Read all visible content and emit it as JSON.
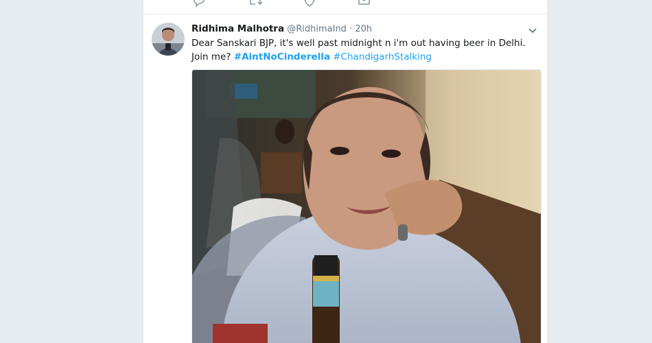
{
  "prev_tweet_actions": [
    {
      "name": "reply-icon"
    },
    {
      "name": "retweet-icon"
    },
    {
      "name": "like-icon"
    },
    {
      "name": "message-icon"
    }
  ],
  "tweet": {
    "author_name": "Ridhima Malhotra",
    "handle": "@RidhimaInd",
    "separator": "·",
    "time": "20h",
    "text_main": "Dear Sanskari BJP, it's well past midnight n i'm out having beer in Delhi. Join me?",
    "hashtag_1": "#AintNoCinderella",
    "hashtag_2": "#ChandigarhStalking",
    "link_color": "#1da1f2",
    "media": "photo-woman-with-beer-bottle",
    "menu_icon": "chevron-down-icon"
  }
}
